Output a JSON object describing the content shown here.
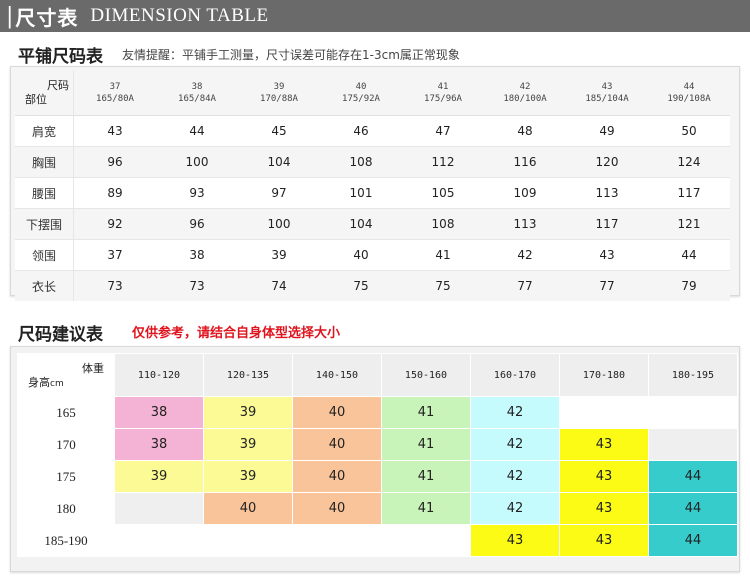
{
  "banner": {
    "bar": "|",
    "title_cn": "尺寸表",
    "title_en": "DIMENSION TABLE"
  },
  "flat_section": {
    "title": "平铺尺码表",
    "note": "友情提醒：平铺手工测量，尺寸误差可能存在1-3cm属正常现象",
    "corner_top": "尺码",
    "corner_bottom": "部位",
    "sizes": [
      {
        "size": "37",
        "spec": "165/80A"
      },
      {
        "size": "38",
        "spec": "165/84A"
      },
      {
        "size": "39",
        "spec": "170/88A"
      },
      {
        "size": "40",
        "spec": "175/92A"
      },
      {
        "size": "41",
        "spec": "175/96A"
      },
      {
        "size": "42",
        "spec": "180/100A"
      },
      {
        "size": "43",
        "spec": "185/104A"
      },
      {
        "size": "44",
        "spec": "190/108A"
      }
    ],
    "rows": [
      {
        "label": "肩宽",
        "values": [
          "43",
          "44",
          "45",
          "46",
          "47",
          "48",
          "49",
          "50"
        ]
      },
      {
        "label": "胸围",
        "values": [
          "96",
          "100",
          "104",
          "108",
          "112",
          "116",
          "120",
          "124"
        ]
      },
      {
        "label": "腰围",
        "values": [
          "89",
          "93",
          "97",
          "101",
          "105",
          "109",
          "113",
          "117"
        ]
      },
      {
        "label": "下摆围",
        "values": [
          "92",
          "96",
          "100",
          "104",
          "108",
          "113",
          "117",
          "121"
        ]
      },
      {
        "label": "领围",
        "values": [
          "37",
          "38",
          "39",
          "40",
          "41",
          "42",
          "43",
          "44"
        ]
      },
      {
        "label": "衣长",
        "values": [
          "73",
          "73",
          "74",
          "75",
          "75",
          "77",
          "77",
          "79"
        ]
      }
    ]
  },
  "suggest_section": {
    "title": "尺码建议表",
    "note": "仅供参考，请结合自身体型选择大小",
    "corner_top": "体重",
    "corner_bottom": "身高",
    "corner_unit": "cm",
    "weights": [
      "110-120",
      "120-135",
      "140-150",
      "150-160",
      "160-170",
      "170-180",
      "180-195"
    ],
    "colors": {
      "c38": "#f4b3d4",
      "c39": "#fbfa94",
      "c40": "#fac49a",
      "c41": "#c8f3b9",
      "c42": "#c6fbfd",
      "c43": "#fbfb16",
      "c44": "#36cccc",
      "empty": "#ffffff",
      "empty_alt": "#efefef"
    },
    "rows": [
      {
        "height": "165",
        "cells": [
          "38",
          "39",
          "40",
          "41",
          "42",
          "",
          ""
        ]
      },
      {
        "height": "170",
        "cells": [
          "38",
          "39",
          "40",
          "41",
          "42",
          "43",
          ""
        ]
      },
      {
        "height": "175",
        "cells": [
          "39",
          "39",
          "40",
          "41",
          "42",
          "43",
          "44"
        ]
      },
      {
        "height": "180",
        "cells": [
          "",
          "40",
          "40",
          "41",
          "42",
          "43",
          "44"
        ]
      },
      {
        "height": "185-190",
        "cells": [
          "",
          "",
          "",
          "",
          "43",
          "43",
          "44"
        ]
      }
    ]
  }
}
